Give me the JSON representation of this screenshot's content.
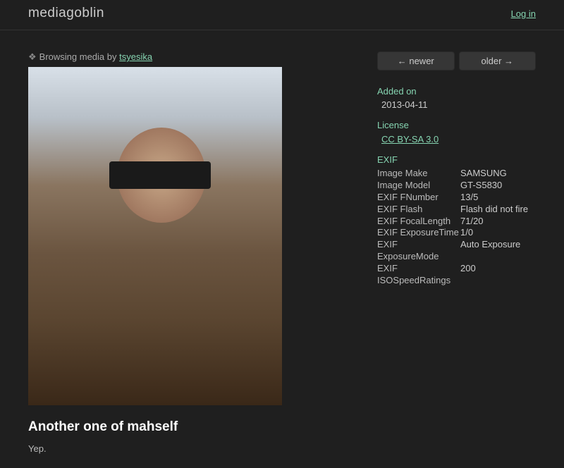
{
  "header": {
    "logo": "mediagoblin",
    "login": "Log in"
  },
  "browsing": {
    "prefix": "❖",
    "text": "Browsing media by ",
    "user": "tsyesika"
  },
  "nav": {
    "newer": "← newer",
    "older": "older →"
  },
  "sidebar": {
    "added_on_label": "Added on",
    "added_on_value": "2013-04-11",
    "license_label": "License",
    "license_value": "CC BY-SA 3.0",
    "exif_label": "EXIF",
    "exif": [
      {
        "key": "Image Make",
        "val": "SAMSUNG"
      },
      {
        "key": "Image Model",
        "val": "GT-S5830"
      },
      {
        "key": "EXIF FNumber",
        "val": "13/5"
      },
      {
        "key": "EXIF Flash",
        "val": "Flash did not fire"
      },
      {
        "key": "EXIF FocalLength",
        "val": "71/20"
      },
      {
        "key": "EXIF ExposureTime",
        "val": "1/0"
      },
      {
        "key": "EXIF ExposureMode",
        "val": "Auto Exposure"
      },
      {
        "key": "EXIF ISOSpeedRatings",
        "val": "200"
      }
    ]
  },
  "media": {
    "title": "Another one of mahself",
    "description": "Yep."
  }
}
